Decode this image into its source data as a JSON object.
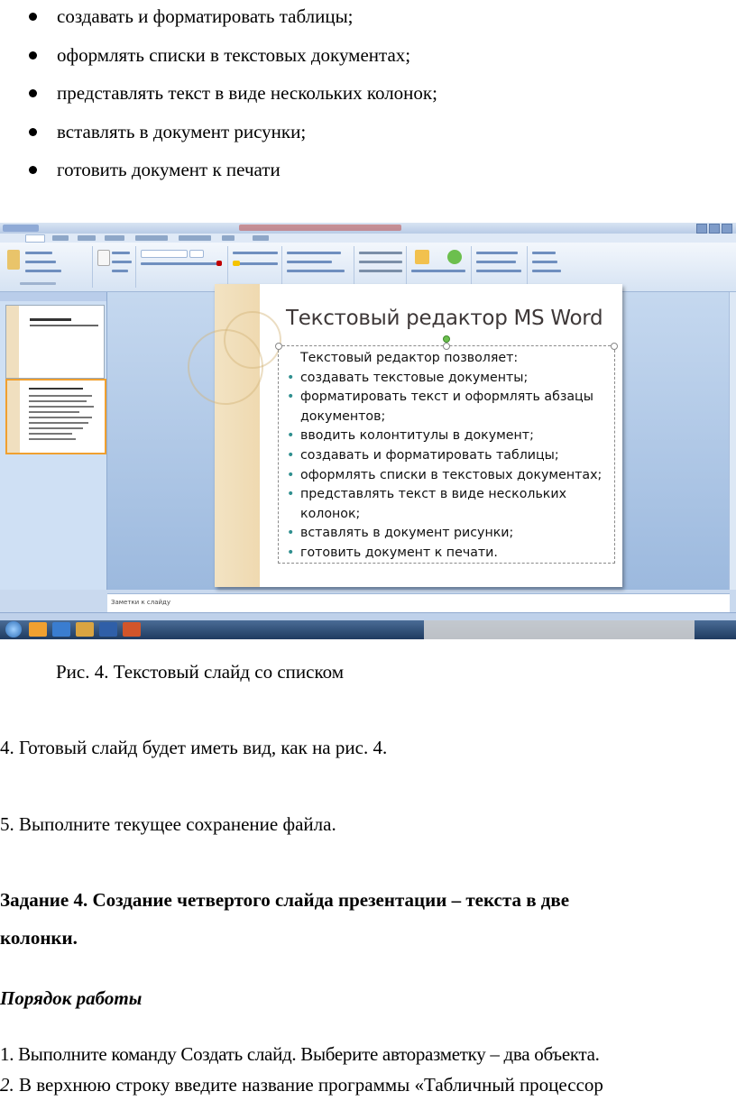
{
  "top_bullets": [
    "создавать и форматировать таблицы;",
    "оформлять списки в текстовых документах;",
    "представлять текст в виде нескольких колонок;",
    "вставлять в документ рисунки;",
    "готовить документ к печати"
  ],
  "slide": {
    "title": "Текстовый редактор MS Word",
    "intro": "Текстовый редактор позволяет:",
    "items": [
      "создавать текстовые документы;",
      "форматировать текст и оформлять абзацы",
      "документов;",
      "вводить колонтитулы в документ;",
      "создавать и форматировать таблицы;",
      "оформлять списки в текстовых документах;",
      "представлять текст в виде нескольких",
      "колонок;",
      "вставлять в документ рисунки;",
      "готовить документ к печати."
    ],
    "notes_placeholder": "Заметки к слайду"
  },
  "caption": "Рис. 4. Текстовый слайд со списком",
  "para_4": "4. Готовый слайд будет иметь вид, как на рис. 4.",
  "para_5": "5. Выполните текущее сохранение файла.",
  "task_heading_line1": "Задание 4. Создание четвертого слайда презентации – текста в две",
  "task_heading_line2": "колонки.",
  "procedure_heading": "Порядок работы",
  "step_1": "1. Выполните команду Создать слайд. Выберите авторазметку – два объекта.",
  "step_2_num": "2.",
  "step_2_text": " В верхнюю строку введите название программы «Табличный процессор"
}
